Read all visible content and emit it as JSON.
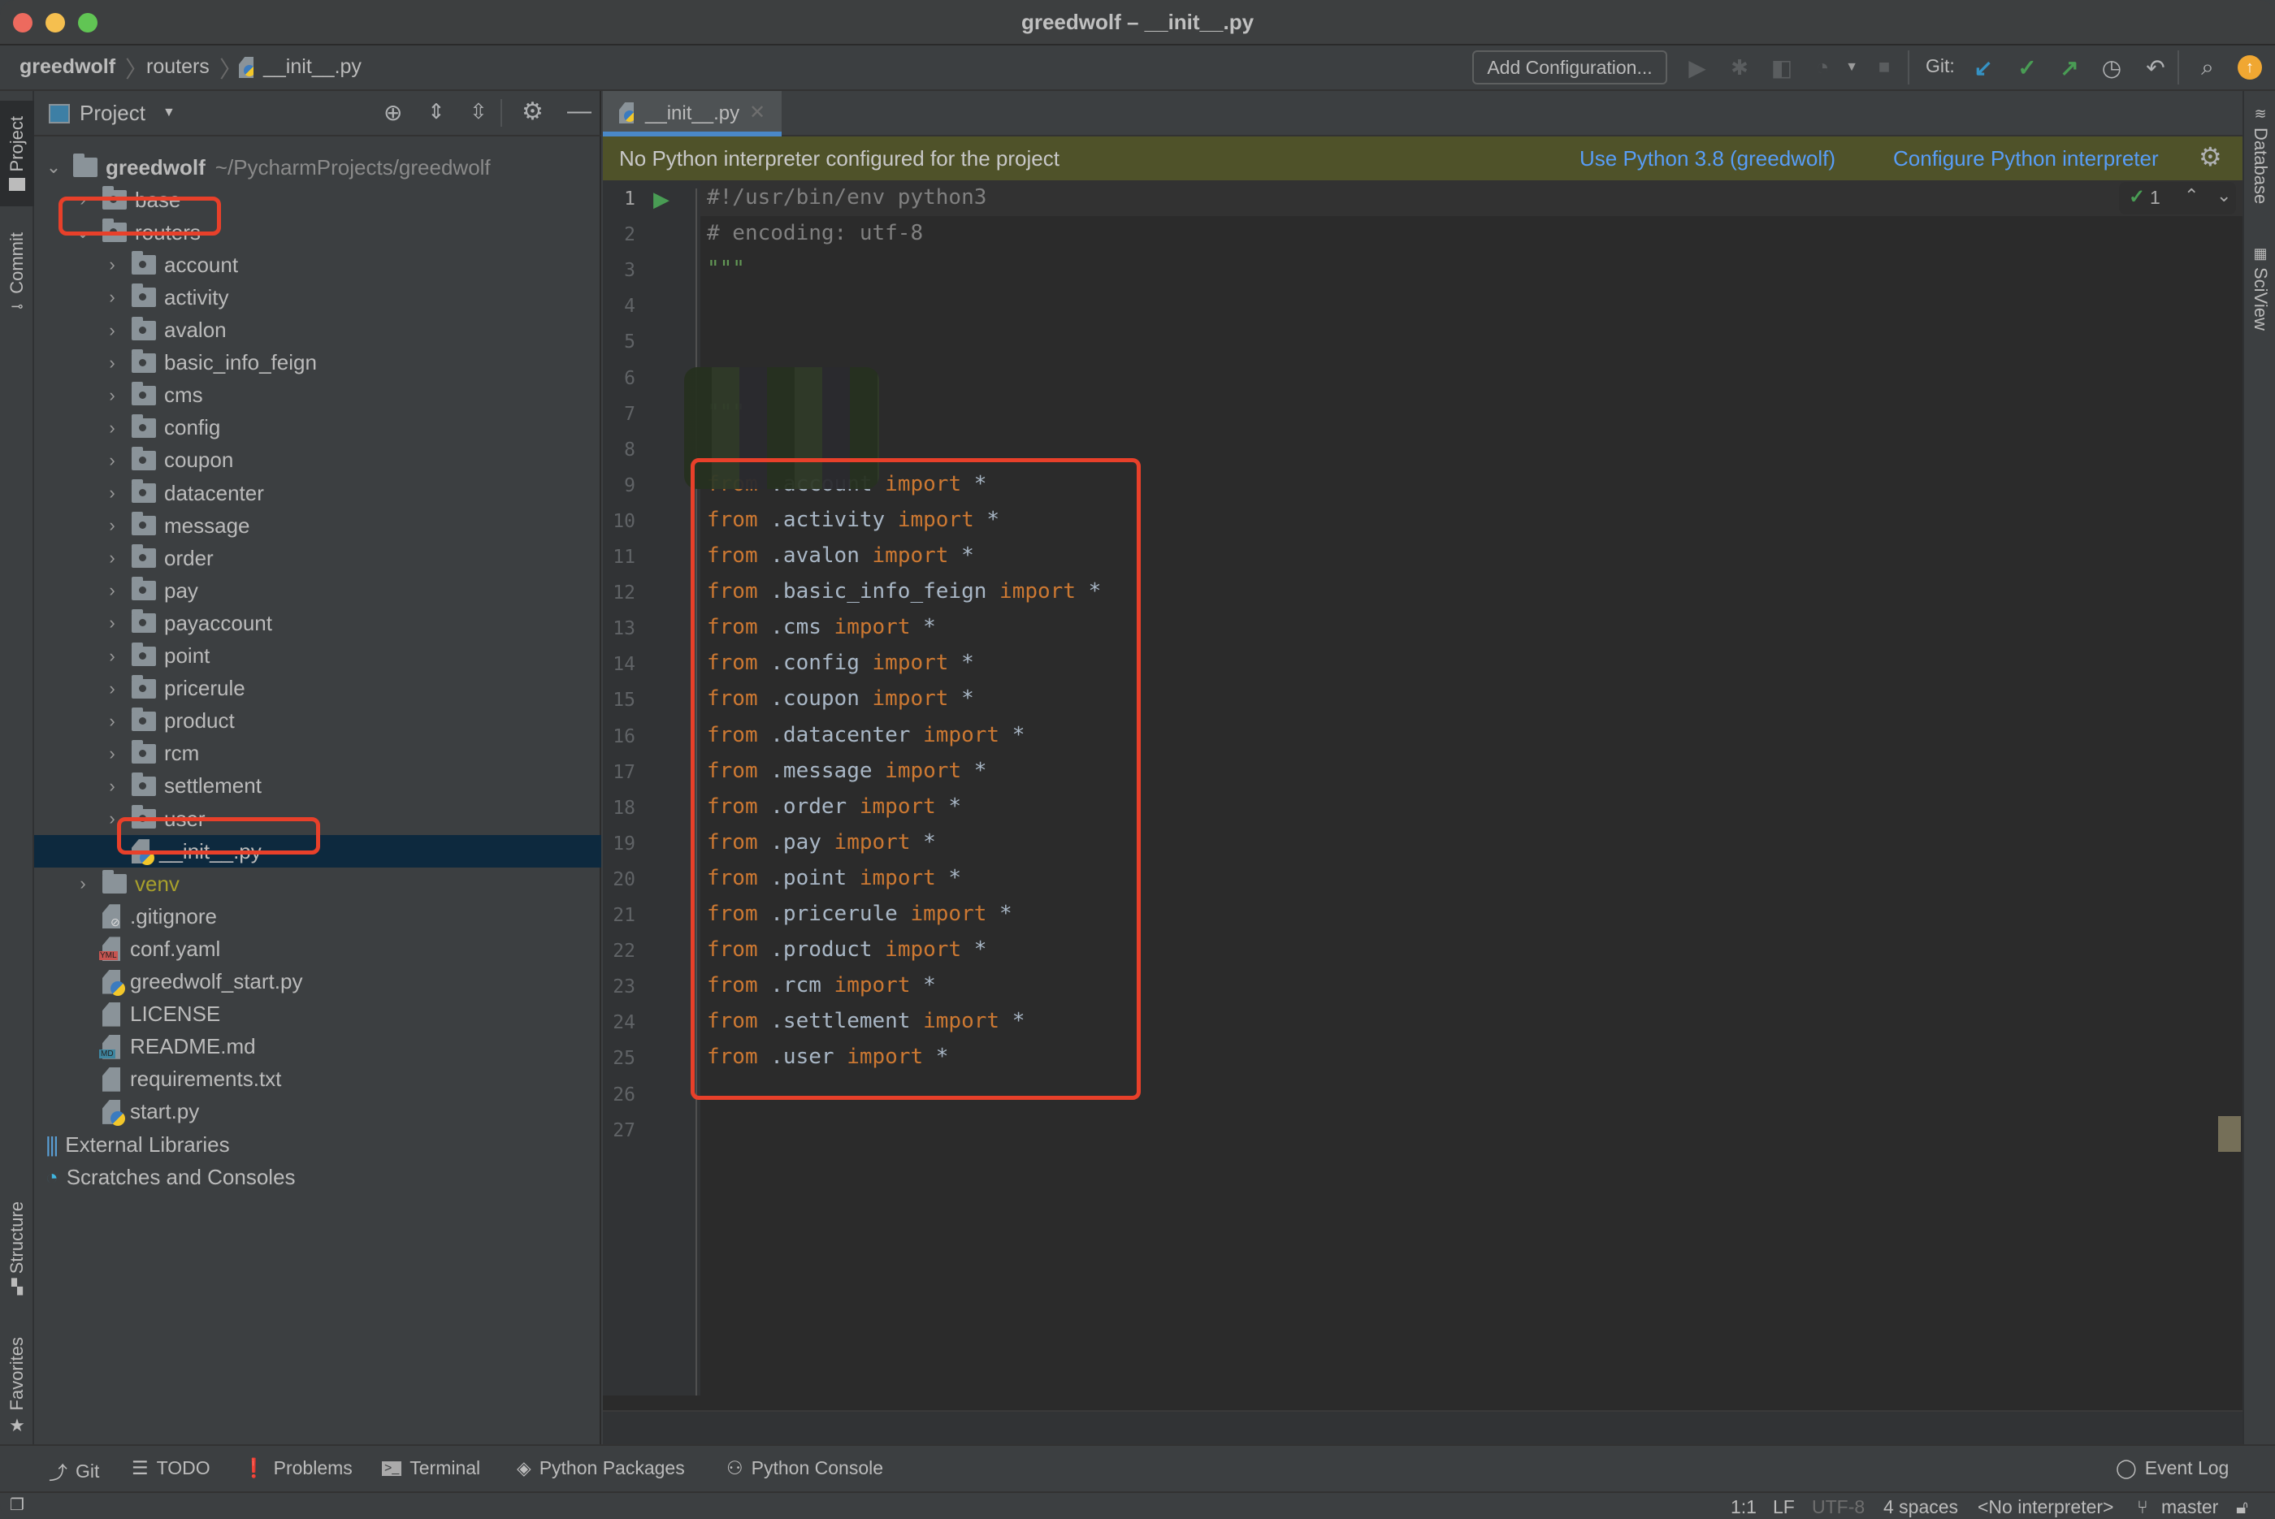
{
  "window": {
    "title": "greedwolf – __init__.py",
    "traffic_lights": {
      "close": "#ed6a5e",
      "minimize": "#f5bf4f",
      "zoom": "#61c554"
    }
  },
  "navbar": {
    "breadcrumb": [
      "greedwolf",
      "routers",
      "__init__.py"
    ],
    "add_configuration": "Add Configuration...",
    "git_label": "Git:",
    "icons": [
      "run-icon",
      "debug-icon",
      "coverage-icon",
      "profile-icon",
      "dropdown-icon",
      "stop-icon",
      "git-update-icon",
      "git-commit-icon",
      "git-push-icon",
      "history-icon",
      "rollback-icon",
      "search-icon",
      "update-icon"
    ]
  },
  "left_strip": {
    "tabs": [
      "Project",
      "Commit",
      "Structure",
      "Favorites"
    ]
  },
  "right_strip": {
    "tabs": [
      "Database",
      "SciView"
    ]
  },
  "project_panel": {
    "title": "Project",
    "root": {
      "name": "greedwolf",
      "path": "~/PycharmProjects/greedwolf"
    },
    "items": [
      {
        "name": "base",
        "type": "package",
        "depth": 1,
        "expanded": false
      },
      {
        "name": "routers",
        "type": "package",
        "depth": 1,
        "expanded": true,
        "highlighted": true
      },
      {
        "name": "account",
        "type": "package",
        "depth": 2
      },
      {
        "name": "activity",
        "type": "package",
        "depth": 2
      },
      {
        "name": "avalon",
        "type": "package",
        "depth": 2
      },
      {
        "name": "basic_info_feign",
        "type": "package",
        "depth": 2
      },
      {
        "name": "cms",
        "type": "package",
        "depth": 2
      },
      {
        "name": "config",
        "type": "package",
        "depth": 2
      },
      {
        "name": "coupon",
        "type": "package",
        "depth": 2
      },
      {
        "name": "datacenter",
        "type": "package",
        "depth": 2
      },
      {
        "name": "message",
        "type": "package",
        "depth": 2
      },
      {
        "name": "order",
        "type": "package",
        "depth": 2
      },
      {
        "name": "pay",
        "type": "package",
        "depth": 2
      },
      {
        "name": "payaccount",
        "type": "package",
        "depth": 2
      },
      {
        "name": "point",
        "type": "package",
        "depth": 2
      },
      {
        "name": "pricerule",
        "type": "package",
        "depth": 2
      },
      {
        "name": "product",
        "type": "package",
        "depth": 2
      },
      {
        "name": "rcm",
        "type": "package",
        "depth": 2
      },
      {
        "name": "settlement",
        "type": "package",
        "depth": 2
      },
      {
        "name": "user",
        "type": "package",
        "depth": 2
      },
      {
        "name": "__init__.py",
        "type": "python",
        "depth": 2,
        "selected": true,
        "highlighted": true
      },
      {
        "name": "venv",
        "type": "folder-excluded",
        "depth": 1,
        "expanded": false
      },
      {
        "name": ".gitignore",
        "type": "gitignore",
        "depth": 1
      },
      {
        "name": "conf.yaml",
        "type": "yaml",
        "depth": 1
      },
      {
        "name": "greedwolf_start.py",
        "type": "python",
        "depth": 1
      },
      {
        "name": "LICENSE",
        "type": "text",
        "depth": 1
      },
      {
        "name": "README.md",
        "type": "markdown",
        "depth": 1
      },
      {
        "name": "requirements.txt",
        "type": "text",
        "depth": 1
      },
      {
        "name": "start.py",
        "type": "python",
        "depth": 1
      }
    ],
    "external_libraries": "External Libraries",
    "scratches": "Scratches and Consoles"
  },
  "editor": {
    "tab": "__init__.py",
    "banner": {
      "message": "No Python interpreter configured for the project",
      "action1": "Use Python 3.8 (greedwolf)",
      "action2": "Configure Python interpreter"
    },
    "inspection": {
      "count": "1"
    },
    "lines": [
      {
        "n": "1",
        "parts": [
          {
            "t": "#!/usr/bin/env python3",
            "c": "cmt"
          }
        ]
      },
      {
        "n": "2",
        "parts": [
          {
            "t": "# encoding: utf-8",
            "c": "cmt"
          }
        ]
      },
      {
        "n": "3",
        "parts": [
          {
            "t": "\"\"\"",
            "c": "str"
          }
        ]
      },
      {
        "n": "4",
        "parts": [],
        "redacted": true
      },
      {
        "n": "5",
        "parts": [],
        "redacted": true
      },
      {
        "n": "6",
        "parts": [],
        "redacted": true
      },
      {
        "n": "7",
        "parts": [
          {
            "t": "\"\"\"",
            "c": "str"
          }
        ]
      },
      {
        "n": "8",
        "parts": []
      },
      {
        "n": "9",
        "parts": [
          {
            "t": "from",
            "c": "kw"
          },
          {
            "t": " .account ",
            "c": ""
          },
          {
            "t": "import",
            "c": "kw"
          },
          {
            "t": " *",
            "c": ""
          }
        ]
      },
      {
        "n": "10",
        "parts": [
          {
            "t": "from",
            "c": "kw"
          },
          {
            "t": " .activity ",
            "c": ""
          },
          {
            "t": "import",
            "c": "kw"
          },
          {
            "t": " *",
            "c": ""
          }
        ]
      },
      {
        "n": "11",
        "parts": [
          {
            "t": "from",
            "c": "kw"
          },
          {
            "t": " .avalon ",
            "c": ""
          },
          {
            "t": "import",
            "c": "kw"
          },
          {
            "t": " *",
            "c": ""
          }
        ]
      },
      {
        "n": "12",
        "parts": [
          {
            "t": "from",
            "c": "kw"
          },
          {
            "t": " .basic_info_feign ",
            "c": ""
          },
          {
            "t": "import",
            "c": "kw"
          },
          {
            "t": " *",
            "c": ""
          }
        ]
      },
      {
        "n": "13",
        "parts": [
          {
            "t": "from",
            "c": "kw"
          },
          {
            "t": " .cms ",
            "c": ""
          },
          {
            "t": "import",
            "c": "kw"
          },
          {
            "t": " *",
            "c": ""
          }
        ]
      },
      {
        "n": "14",
        "parts": [
          {
            "t": "from",
            "c": "kw"
          },
          {
            "t": " .config ",
            "c": ""
          },
          {
            "t": "import",
            "c": "kw"
          },
          {
            "t": " *",
            "c": ""
          }
        ]
      },
      {
        "n": "15",
        "parts": [
          {
            "t": "from",
            "c": "kw"
          },
          {
            "t": " .coupon ",
            "c": ""
          },
          {
            "t": "import",
            "c": "kw"
          },
          {
            "t": " *",
            "c": ""
          }
        ]
      },
      {
        "n": "16",
        "parts": [
          {
            "t": "from",
            "c": "kw"
          },
          {
            "t": " .datacenter ",
            "c": ""
          },
          {
            "t": "import",
            "c": "kw"
          },
          {
            "t": " *",
            "c": ""
          }
        ]
      },
      {
        "n": "17",
        "parts": [
          {
            "t": "from",
            "c": "kw"
          },
          {
            "t": " .message ",
            "c": ""
          },
          {
            "t": "import",
            "c": "kw"
          },
          {
            "t": " *",
            "c": ""
          }
        ]
      },
      {
        "n": "18",
        "parts": [
          {
            "t": "from",
            "c": "kw"
          },
          {
            "t": " .order ",
            "c": ""
          },
          {
            "t": "import",
            "c": "kw"
          },
          {
            "t": " *",
            "c": ""
          }
        ]
      },
      {
        "n": "19",
        "parts": [
          {
            "t": "from",
            "c": "kw"
          },
          {
            "t": " .pay ",
            "c": ""
          },
          {
            "t": "import",
            "c": "kw"
          },
          {
            "t": " *",
            "c": ""
          }
        ]
      },
      {
        "n": "20",
        "parts": [
          {
            "t": "from",
            "c": "kw"
          },
          {
            "t": " .point ",
            "c": ""
          },
          {
            "t": "import",
            "c": "kw"
          },
          {
            "t": " *",
            "c": ""
          }
        ]
      },
      {
        "n": "21",
        "parts": [
          {
            "t": "from",
            "c": "kw"
          },
          {
            "t": " .pricerule ",
            "c": ""
          },
          {
            "t": "import",
            "c": "kw"
          },
          {
            "t": " *",
            "c": ""
          }
        ]
      },
      {
        "n": "22",
        "parts": [
          {
            "t": "from",
            "c": "kw"
          },
          {
            "t": " .product ",
            "c": ""
          },
          {
            "t": "import",
            "c": "kw"
          },
          {
            "t": " *",
            "c": ""
          }
        ]
      },
      {
        "n": "23",
        "parts": [
          {
            "t": "from",
            "c": "kw"
          },
          {
            "t": " .rcm ",
            "c": ""
          },
          {
            "t": "import",
            "c": "kw"
          },
          {
            "t": " *",
            "c": ""
          }
        ]
      },
      {
        "n": "24",
        "parts": [
          {
            "t": "from",
            "c": "kw"
          },
          {
            "t": " .settlement ",
            "c": ""
          },
          {
            "t": "import",
            "c": "kw"
          },
          {
            "t": " *",
            "c": ""
          }
        ]
      },
      {
        "n": "25",
        "parts": [
          {
            "t": "from",
            "c": "kw"
          },
          {
            "t": " .user ",
            "c": ""
          },
          {
            "t": "import",
            "c": "kw"
          },
          {
            "t": " *",
            "c": ""
          }
        ]
      },
      {
        "n": "26",
        "parts": []
      },
      {
        "n": "27",
        "parts": []
      }
    ]
  },
  "tool_windows": [
    "Git",
    "TODO",
    "Problems",
    "Terminal",
    "Python Packages",
    "Python Console"
  ],
  "event_log": "Event Log",
  "status_bar": {
    "position": "1:1",
    "line_sep": "LF",
    "encoding": "UTF-8",
    "indent": "4 spaces",
    "interpreter": "<No interpreter>",
    "branch": "master"
  },
  "colors": {
    "highlight_box": "#e8402a",
    "link": "#589df6",
    "banner_bg": "#4f5229",
    "keyword": "#cc7832",
    "selection": "#0d293e"
  }
}
